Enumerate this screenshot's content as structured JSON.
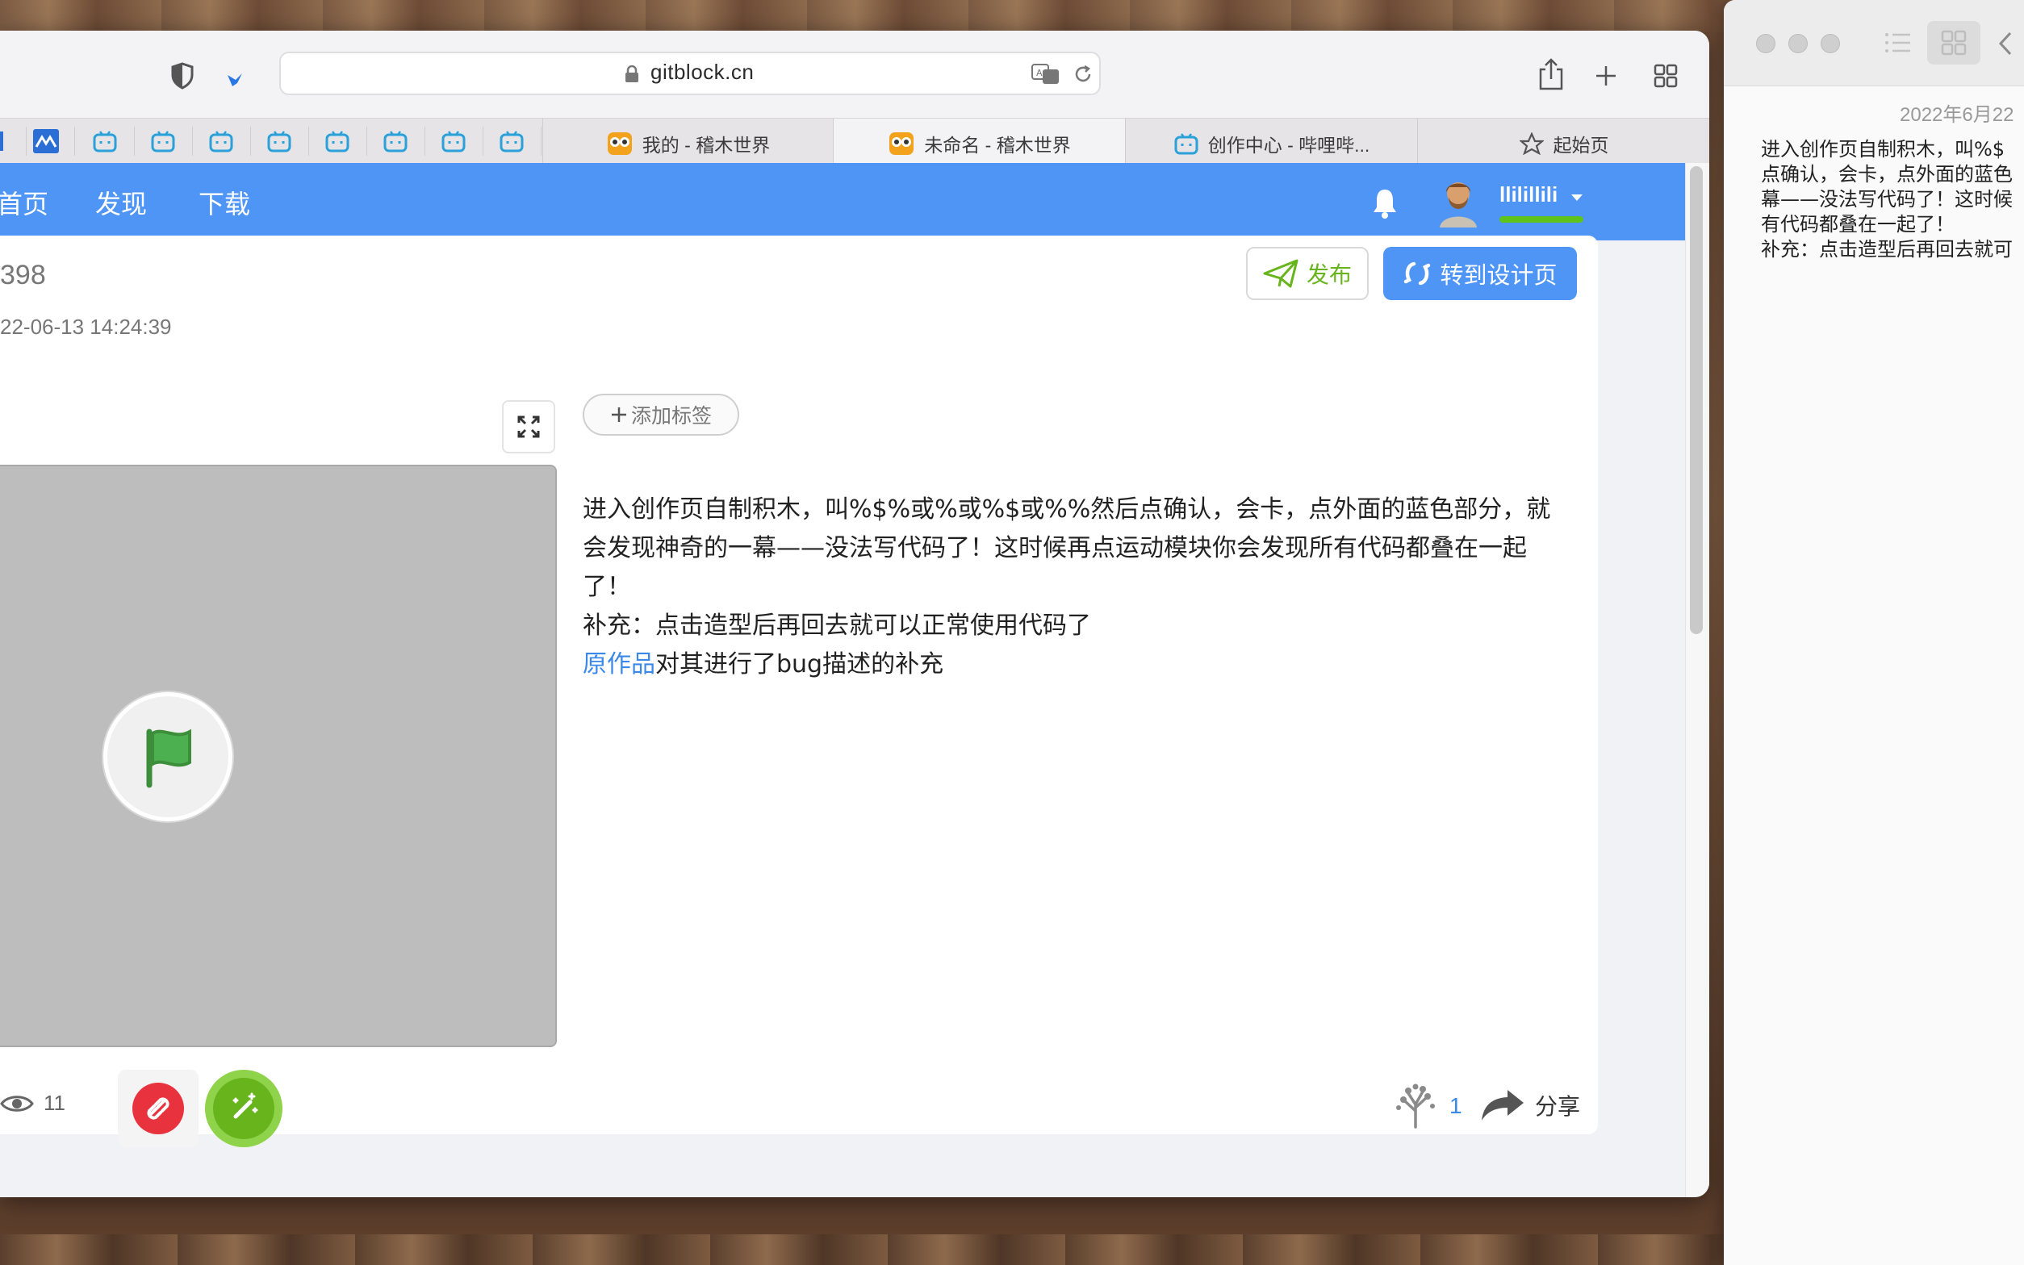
{
  "browser": {
    "url": "gitblock.cn",
    "tabs": [
      {
        "label": "我的 - 稽木世界"
      },
      {
        "label": "未命名 - 稽木世界"
      },
      {
        "label": "创作中心 - 哔哩哔..."
      },
      {
        "label": "起始页"
      }
    ],
    "pinned_icons": [
      "gitblock-icon",
      "bilibili-icon",
      "bilibili-icon",
      "bilibili-icon",
      "bilibili-icon",
      "bilibili-icon",
      "bilibili-icon",
      "bilibili-icon",
      "bilibili-icon"
    ]
  },
  "site": {
    "nav": [
      "首页",
      "发现",
      "下载"
    ],
    "username": "llilillili",
    "brand_color": "#4e95f5"
  },
  "project": {
    "id_fragment": "398",
    "date_fragment": "22-06-13 14:24:39",
    "publish_label": "发布",
    "design_label": "转到设计页",
    "add_tag_label": "添加标签",
    "description": [
      "进入创作页自制积木，叫%$%或%或%$或%%然后点确认，会卡，点外面的蓝色部分，就会发现神奇的一幕——没法写代码了！这时候再点运动模块你会发现所有代码都叠在一起了！",
      "补充：点击造型后再回去就可以正常使用代码了"
    ],
    "original_link": "原作品",
    "original_suffix": "对其进行了bug描述的补充",
    "views": "11",
    "tree_count": "1",
    "share_label": "分享"
  },
  "notes": {
    "date": "2022年6月22",
    "lines": [
      "进入创作页自制积木，叫%$",
      "点确认，会卡，点外面的蓝色",
      "幕——没法写代码了！这时候",
      "有代码都叠在一起了！",
      "补充：点击造型后再回去就可"
    ]
  }
}
